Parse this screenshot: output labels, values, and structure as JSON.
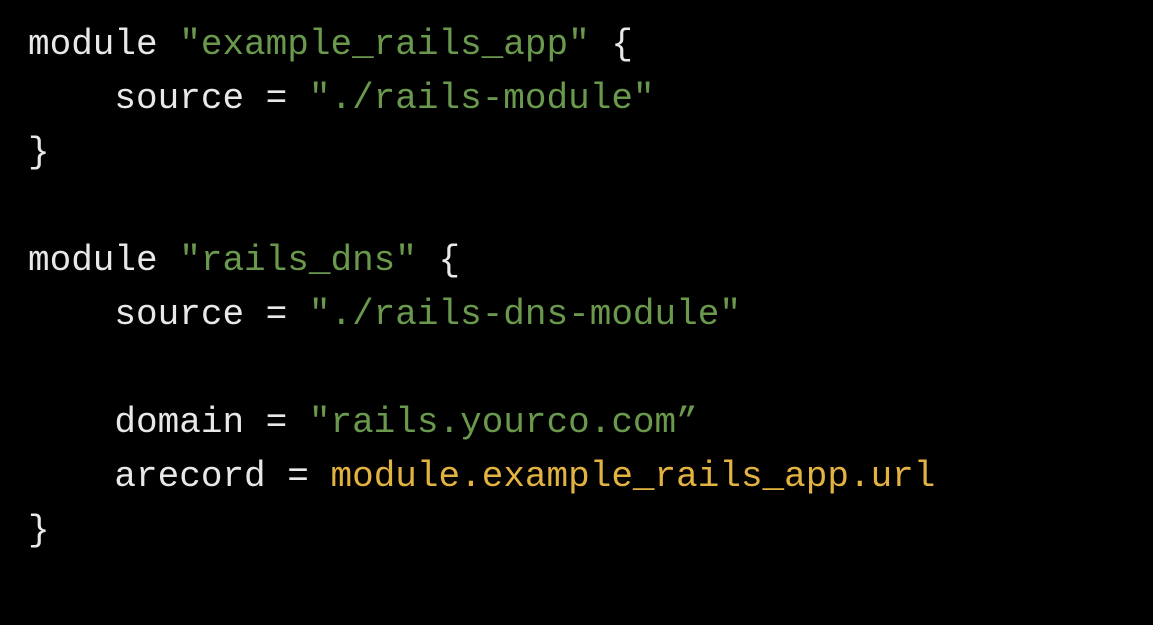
{
  "code": {
    "line1": {
      "keyword": "module",
      "name": "\"example_rails_app\"",
      "brace": "{"
    },
    "line2": {
      "attr": "source",
      "eq": "=",
      "value": "\"./rails-module\""
    },
    "line3": {
      "brace": "}"
    },
    "line5": {
      "keyword": "module",
      "name": "\"rails_dns\"",
      "brace": "{"
    },
    "line6": {
      "attr": "source",
      "eq": "=",
      "value": "\"./rails-dns-module\""
    },
    "line8": {
      "attr": "domain",
      "eq": "=",
      "value": "\"rails.yourco.com”"
    },
    "line9": {
      "attr": "arecord",
      "eq": "=",
      "ref": "module.example_rails_app.url"
    },
    "line10": {
      "brace": "}"
    }
  }
}
